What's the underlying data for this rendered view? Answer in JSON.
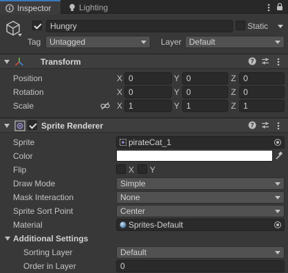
{
  "tabs": [
    {
      "label": "Inspector",
      "icon": "info-icon",
      "active": true
    },
    {
      "label": "Lighting",
      "icon": "bulb-icon",
      "active": false
    }
  ],
  "object": {
    "active": true,
    "name": "Hungry",
    "static_label": "Static",
    "static": false,
    "tag_label": "Tag",
    "tag_value": "Untagged",
    "layer_label": "Layer",
    "layer_value": "Default"
  },
  "transform": {
    "title": "Transform",
    "rows": [
      {
        "label": "Position",
        "x": "0",
        "y": "0",
        "z": "0"
      },
      {
        "label": "Rotation",
        "x": "0",
        "y": "0",
        "z": "0"
      },
      {
        "label": "Scale",
        "x": "1",
        "y": "1",
        "z": "1"
      }
    ],
    "axes": {
      "x": "X",
      "y": "Y",
      "z": "Z"
    }
  },
  "sprite_renderer": {
    "title": "Sprite Renderer",
    "enabled": true,
    "sprite_label": "Sprite",
    "sprite_value": "pirateCat_1",
    "color_label": "Color",
    "color_value": "#ffffff",
    "flip_label": "Flip",
    "flip_x_label": "X",
    "flip_y_label": "Y",
    "draw_mode_label": "Draw Mode",
    "draw_mode_value": "Simple",
    "mask_label": "Mask Interaction",
    "mask_value": "None",
    "sort_point_label": "Sprite Sort Point",
    "sort_point_value": "Center",
    "material_label": "Material",
    "material_value": "Sprites-Default"
  },
  "additional": {
    "title": "Additional Settings",
    "sorting_layer_label": "Sorting Layer",
    "sorting_layer_value": "Default",
    "order_label": "Order in Layer",
    "order_value": "0"
  },
  "colors": {
    "accent": "#3a79bb",
    "panel_bg": "#383838",
    "header_bg": "#3e3e3e",
    "field_bg": "#2a2a2a",
    "dropdown_bg": "#515151"
  }
}
